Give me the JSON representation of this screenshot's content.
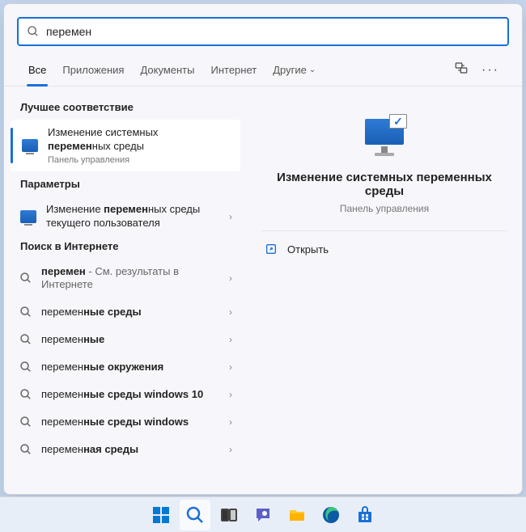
{
  "search": {
    "query": "перемен"
  },
  "tabs": {
    "all": "Все",
    "apps": "Приложения",
    "docs": "Документы",
    "web": "Интернет",
    "more": "Другие"
  },
  "sections": {
    "best": "Лучшее соответствие",
    "settings": "Параметры",
    "web": "Поиск в Интернете"
  },
  "bestMatch": {
    "line1_pre": "Изменение системных ",
    "line2_bold": "перемен",
    "line2_post": "ных среды",
    "sub": "Панель управления"
  },
  "settingsItem": {
    "pre": "Изменение ",
    "bold": "перемен",
    "post": "ных среды текущего пользователя"
  },
  "web0": {
    "bold": "перемен",
    "post": " - См. результаты в Интернете"
  },
  "web1": {
    "pre": "перемен",
    "bold": "ные среды"
  },
  "web2": {
    "pre": "перемен",
    "bold": "ные"
  },
  "web3": {
    "pre": "перемен",
    "bold": "ные окружения"
  },
  "web4": {
    "pre": "перемен",
    "bold": "ные среды windows 10"
  },
  "web5": {
    "pre": "перемен",
    "bold": "ные среды windows"
  },
  "web6": {
    "pre": "перемен",
    "bold": "ная среды"
  },
  "preview": {
    "title": "Изменение системных переменных среды",
    "sub": "Панель управления",
    "open": "Открыть"
  }
}
